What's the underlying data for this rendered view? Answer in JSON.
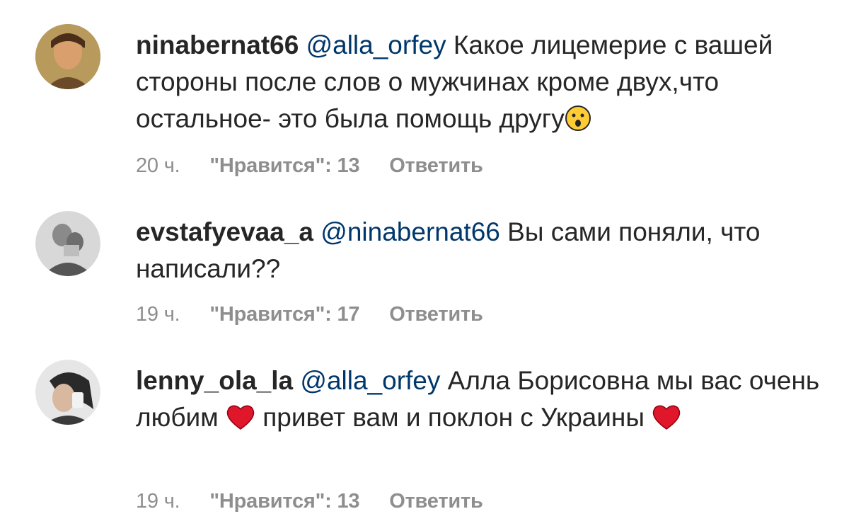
{
  "colors": {
    "text": "#262626",
    "mention": "#00376b",
    "meta": "#8e8e8e"
  },
  "comments": [
    {
      "username": "ninabernat66",
      "mention": "@alla_orfey",
      "text": "Какое лицемерие с вашей стороны после слов о мужчинах кроме двух,что остальное- это была помощь другу",
      "emoji": "astonished-face-icon",
      "time": "20 ч.",
      "likes": "\"Нравится\": 13",
      "reply": "Ответить"
    },
    {
      "username": "evstafyevaa_a",
      "mention": "@ninabernat66",
      "text": "Вы сами поняли, что написали??",
      "time": "19 ч.",
      "likes": "\"Нравится\": 17",
      "reply": "Ответить"
    },
    {
      "username": "lenny_ola_la",
      "mention": "@alla_orfey",
      "text_part1": "Алла Борисовна мы вас очень любим",
      "text_part2": "привет вам и поклон с Украины",
      "emoji": "heart-icon",
      "time": "19 ч.",
      "likes": "\"Нравится\": 13",
      "reply": "Ответить"
    }
  ]
}
